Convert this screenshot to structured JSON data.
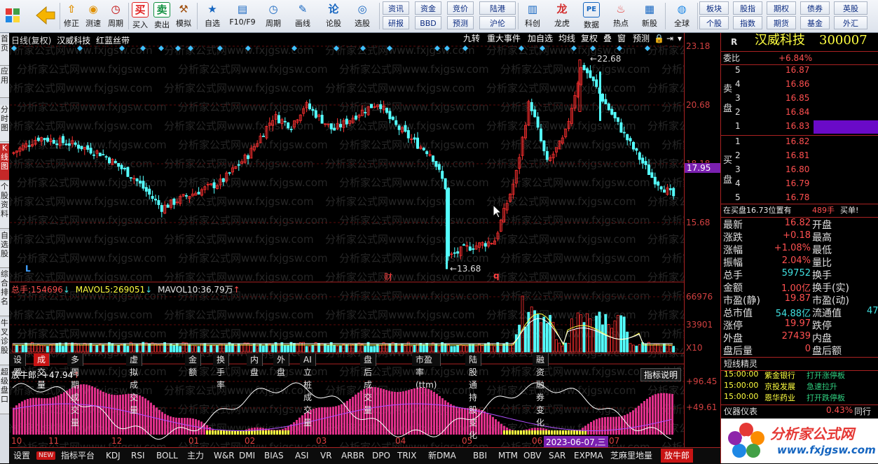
{
  "toolbar": {
    "items": [
      {
        "label": "修正",
        "icon": "arrow-up-icon"
      },
      {
        "label": "测速",
        "icon": "speed-icon"
      },
      {
        "label": "买入",
        "icon": "buy-icon"
      },
      {
        "label": "卖出",
        "icon": "sell-icon"
      },
      {
        "label": "模拟",
        "icon": "hammer-icon"
      },
      {
        "label": "自选",
        "icon": "star-icon"
      },
      {
        "label": "F10/F9",
        "icon": "f10-icon"
      },
      {
        "label": "周期",
        "icon": "clock-icon"
      },
      {
        "label": "画线",
        "icon": "pen-icon"
      },
      {
        "label": "论股",
        "icon": "forum-icon"
      },
      {
        "label": "选股",
        "icon": "select-stock-icon"
      }
    ],
    "quick_top": [
      "资讯",
      "资金",
      "竞价",
      "陆港"
    ],
    "quick_bottom": [
      "研报",
      "BBD",
      "预测",
      "沪伦"
    ],
    "feature": [
      {
        "label": "科创",
        "icon": "chart-icon"
      },
      {
        "label": "龙虎",
        "icon": "dragon-icon"
      },
      {
        "label": "数据",
        "icon": "pe-icon"
      },
      {
        "label": "热点",
        "icon": "hot-icon"
      },
      {
        "label": "新股",
        "icon": "ipo-icon"
      },
      {
        "label": "全球",
        "icon": "globe-icon"
      }
    ],
    "right_top": [
      "板块",
      "股指",
      "期权",
      "债券",
      "英股"
    ],
    "right_bottom": [
      "个股",
      "指数",
      "期货",
      "基金",
      "外汇"
    ],
    "buy_glyph": "买",
    "sell_glyph": "卖"
  },
  "left_tabs": [
    "首页",
    "应用",
    "分时图",
    "K线图",
    "个股资料",
    "自选股",
    "综合排名",
    "牛叉诊股",
    "超级盘口"
  ],
  "chart": {
    "title": "日线(复权)",
    "stock": "汉威科技",
    "overlay": "红蓝丝带",
    "tags": [
      "九转",
      "重大事件",
      "加自选",
      "均线",
      "复权",
      "叠",
      "窗",
      "预测"
    ],
    "price_axis": [
      "23.18",
      "20.68",
      "18.18",
      "15.68"
    ],
    "current_price": "17.95",
    "high_label": "22.68",
    "low_label": "13.68",
    "markers": [
      "L",
      "财",
      "q"
    ],
    "vol_legend": {
      "total_label": "总手:",
      "total": "154696",
      "ma5_label": "MAVOL5:",
      "ma5": "269051",
      "ma10_label": "MAVOL10:",
      "ma10": "36.79万"
    },
    "vol_axis": [
      "66976",
      "33901",
      "X10"
    ],
    "vol_tabs": [
      "设置",
      "成交量",
      "多周期成交量",
      "虚拟成交量",
      "金额",
      "换手率",
      "内盘",
      "外盘",
      "AI立桩成交量",
      "盘后成交量",
      "市盈率(ttm)",
      "陆股通持股变化",
      "融资融券变化"
    ],
    "ind_legend": "放牛郎: +47.94",
    "ind_button": "指标说明",
    "ind_axis": [
      "+96.45",
      "+49.61"
    ],
    "dates": [
      "10",
      "11",
      "12",
      "01",
      "02",
      "03",
      "04",
      "05",
      "06",
      "07"
    ],
    "cursor_date": "2023-06-07,三",
    "watermark": "分析家公式网www.fxjgsw.com"
  },
  "quote": {
    "code_r": "R",
    "name": "汉威科技",
    "code": "300007",
    "weibi_label": "委比",
    "weibi": "+6.84%",
    "sell_label": "卖盘",
    "buy_label": "买盘",
    "asks": [
      [
        "5",
        "16.87"
      ],
      [
        "4",
        "16.86"
      ],
      [
        "3",
        "16.85"
      ],
      [
        "2",
        "16.84"
      ],
      [
        "1",
        "16.83"
      ]
    ],
    "bids": [
      [
        "1",
        "16.82"
      ],
      [
        "2",
        "16.81"
      ],
      [
        "3",
        "16.80"
      ],
      [
        "4",
        "16.79"
      ],
      [
        "5",
        "16.78"
      ]
    ],
    "note": "在买盘16.73位置有",
    "note_vol": "489手",
    "note_tail": "买单!",
    "stats": [
      [
        "最新",
        "16.82",
        "开盘",
        ""
      ],
      [
        "涨跌",
        "+0.18",
        "最高",
        ""
      ],
      [
        "涨幅",
        "+1.08%",
        "最低",
        ""
      ],
      [
        "振幅",
        "2.04%",
        "量比",
        ""
      ],
      [
        "总手",
        "59752",
        "换手",
        ""
      ],
      [
        "金额",
        "1.00亿",
        "换手(实)",
        ""
      ],
      [
        "市盈(静)",
        "19.87",
        "市盈(动)",
        ""
      ],
      [
        "总市值",
        "54.88亿",
        "流通值",
        "47"
      ],
      [
        "涨停",
        "19.97",
        "跌停",
        ""
      ],
      [
        "外盘",
        "27439",
        "内盘",
        ""
      ],
      [
        "盘后量",
        "0",
        "盘后额",
        ""
      ]
    ],
    "sprite_title": "短线精灵",
    "sprites": [
      [
        "15:00:00",
        "紫金银行",
        "打开涨停板"
      ],
      [
        "15:00:00",
        "京投发展",
        "急速拉升"
      ],
      [
        "15:00:00",
        "恩华药业",
        "打开跌停板"
      ]
    ],
    "gauge_label": "仪器仪表",
    "gauge_value": "0.43%",
    "gauge_tab": "同行",
    "logo_text": "分析家公式网",
    "logo_url": "www.fxjgsw.com"
  },
  "bottom_tabs": [
    "设置",
    "NEW",
    "指标平台",
    "KDJ",
    "RSI",
    "BOLL",
    "主力",
    "W&R",
    "DMI",
    "BIAS",
    "ASI",
    "VR",
    "ARBR",
    "DPO",
    "TRIX",
    "新DMA",
    "BBI",
    "MTM",
    "OBV",
    "SAR",
    "EXPMA",
    "芝麻里地量",
    "放牛郎"
  ]
}
